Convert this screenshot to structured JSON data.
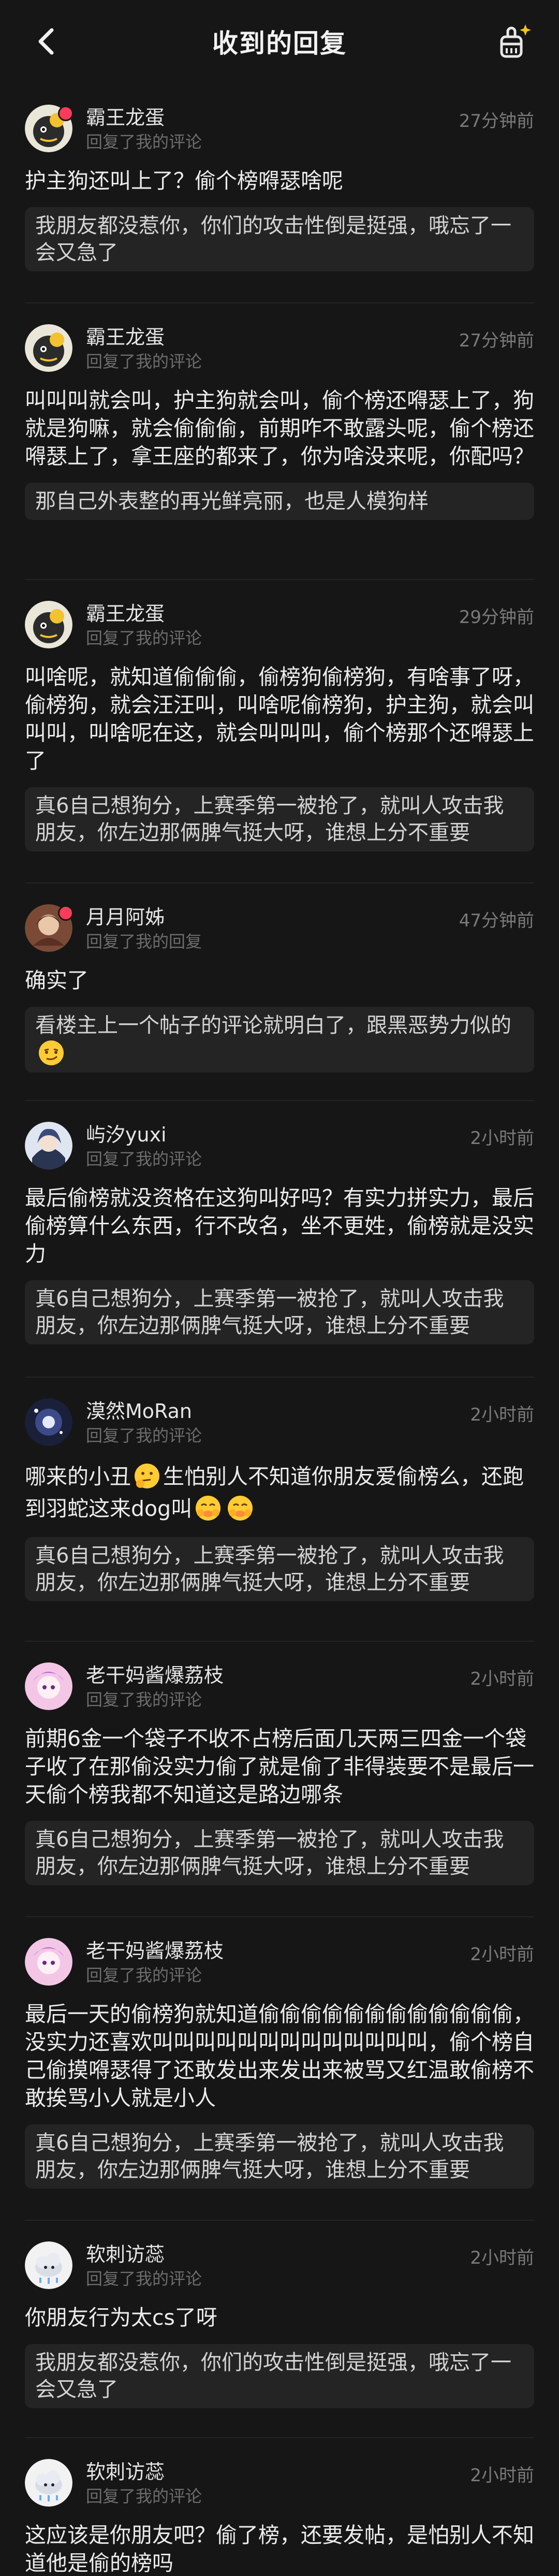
{
  "header": {
    "title": "收到的回复"
  },
  "items": [
    {
      "username": "霸王龙蛋",
      "sub": "回复了我的评论",
      "time": "27分钟前",
      "reply": "护主狗还叫上了？偷个榜嘚瑟啥呢",
      "quote": "我朋友都没惹你，你们的攻击性倒是挺强，哦忘了一会又急了",
      "avatar": "dino-avatar"
    },
    {
      "username": "霸王龙蛋",
      "sub": "回复了我的评论",
      "time": "27分钟前",
      "reply": "叫叫叫就会叫，护主狗就会叫，偷个榜还嘚瑟上了，狗就是狗嘛，就会偷偷偷，前期咋不敢露头呢，偷个榜还嘚瑟上了，拿王座的都来了，你为啥没来呢，你配吗？",
      "quote": "那自己外表整的再光鲜亮丽，也是人模狗样",
      "avatar": "dino-avatar"
    },
    {
      "username": "霸王龙蛋",
      "sub": "回复了我的评论",
      "time": "29分钟前",
      "reply": "叫啥呢，就知道偷偷偷，偷榜狗偷榜狗，有啥事了呀，偷榜狗，就会汪汪叫，叫啥呢偷榜狗，护主狗，就会叫叫叫，叫啥呢在这，就会叫叫叫，偷个榜那个还嘚瑟上了",
      "quote": "真6自己想狗分，上赛季第一被抢了，就叫人攻击我朋友，你左边那俩脾气挺大呀，谁想上分不重要",
      "avatar": "dino-avatar"
    },
    {
      "username": "月月阿姊",
      "sub": "回复了我的回复",
      "time": "47分钟前",
      "reply": "确实了",
      "quote_a": "看楼主上一个帖子的评论就明白了，跟黑恶势力似的",
      "avatar": "girl-avatar"
    },
    {
      "username": "屿汐yuxi",
      "sub": "回复了我的评论",
      "time": "2小时前",
      "reply": "最后偷榜就没资格在这狗叫好吗？有实力拼实力，最后偷榜算什么东西，行不改名，坐不更姓，偷榜就是没实力",
      "quote": "真6自己想狗分，上赛季第一被抢了，就叫人攻击我朋友，你左边那俩脾气挺大呀，谁想上分不重要",
      "avatar": "anime-avatar"
    },
    {
      "username": "漠然MoRan",
      "sub": "回复了我的评论",
      "time": "2小时前",
      "reply_a": "哪来的小丑",
      "reply_b": "生怕别人不知道你朋友爱偷榜么，还跑到羽蛇这来dog叫",
      "quote": "真6自己想狗分，上赛季第一被抢了，就叫人攻击我朋友，你左边那俩脾气挺大呀，谁想上分不重要",
      "avatar": "dark-avatar"
    },
    {
      "username": "老干妈酱爆荔枝",
      "sub": "回复了我的评论",
      "time": "2小时前",
      "reply": "前期6金一个袋子不收不占榜后面几天两三四金一个袋子收了在那偷没实力偷了就是偷了非得装要不是最后一天偷个榜我都不知道这是路边哪条",
      "quote": "真6自己想狗分，上赛季第一被抢了，就叫人攻击我朋友，你左边那俩脾气挺大呀，谁想上分不重要",
      "avatar": "pink-avatar"
    },
    {
      "username": "老干妈酱爆荔枝",
      "sub": "回复了我的评论",
      "time": "2小时前",
      "reply": "最后一天的偷榜狗就知道偷偷偷偷偷偷偷偷偷偷偷偷，没实力还喜欢叫叫叫叫叫叫叫叫叫叫叫叫叫，偷个榜自己偷摸嘚瑟得了还敢发出来发出来被骂又红温敢偷榜不敢挨骂小人就是小人",
      "quote": "真6自己想狗分，上赛季第一被抢了，就叫人攻击我朋友，你左边那俩脾气挺大呀，谁想上分不重要",
      "avatar": "pink-avatar"
    },
    {
      "username": "软刺访蕊",
      "sub": "回复了我的评论",
      "time": "2小时前",
      "reply": "你朋友行为太cs了呀",
      "quote": "我朋友都没惹你，你们的攻击性倒是挺强，哦忘了一会又急了",
      "avatar": "cloud-avatar"
    },
    {
      "username": "软刺访蕊",
      "sub": "回复了我的评论",
      "time": "2小时前",
      "reply": "这应该是你朋友吧？偷了榜，还要发帖，是怕别人不知道他是偷的榜吗",
      "avatar": "cloud-avatar"
    }
  ]
}
